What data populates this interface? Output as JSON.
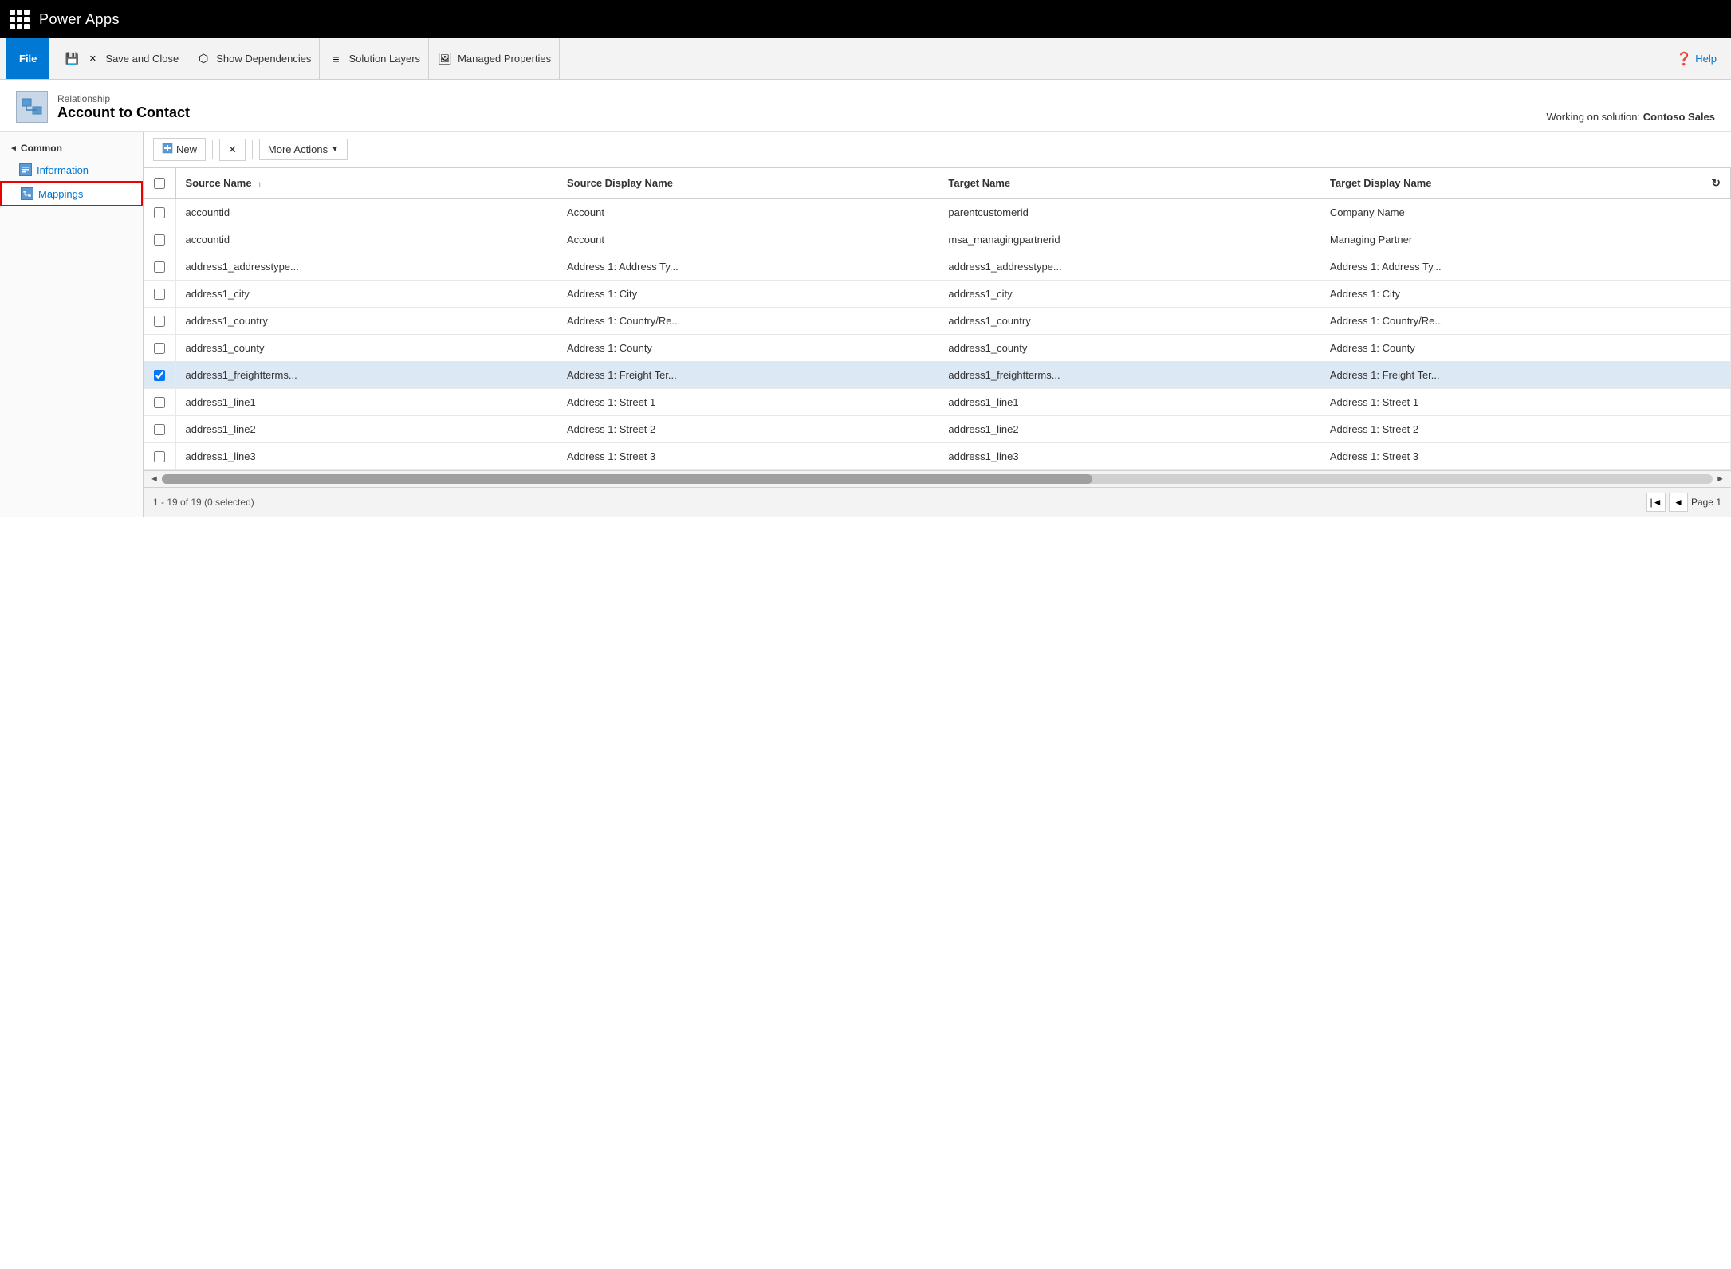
{
  "app": {
    "title": "Power Apps"
  },
  "ribbon": {
    "file_label": "File",
    "save_close_label": "Save and Close",
    "show_dependencies_label": "Show Dependencies",
    "solution_layers_label": "Solution Layers",
    "managed_properties_label": "Managed Properties",
    "help_label": "Help"
  },
  "page": {
    "subtitle": "Relationship",
    "title": "Account to Contact",
    "working_on": "Working on solution: Contoso Sales"
  },
  "sidebar": {
    "section_label": "Common",
    "items": [
      {
        "label": "Information",
        "active": false
      },
      {
        "label": "Mappings",
        "active": true
      }
    ]
  },
  "toolbar": {
    "new_label": "New",
    "delete_label": "✕",
    "more_actions_label": "More Actions"
  },
  "table": {
    "columns": [
      {
        "label": ""
      },
      {
        "label": "Source Name",
        "sortable": true,
        "sort_dir": "asc"
      },
      {
        "label": "Source Display Name",
        "sortable": false
      },
      {
        "label": "Target Name",
        "sortable": false
      },
      {
        "label": "Target Display Name",
        "sortable": false
      }
    ],
    "rows": [
      {
        "source_name": "accountid",
        "source_display": "Account",
        "target_name": "parentcustomerid",
        "target_display": "Company Name",
        "selected": false
      },
      {
        "source_name": "accountid",
        "source_display": "Account",
        "target_name": "msa_managingpartnerid",
        "target_display": "Managing Partner",
        "selected": false
      },
      {
        "source_name": "address1_addresstype...",
        "source_display": "Address 1: Address Ty...",
        "target_name": "address1_addresstype...",
        "target_display": "Address 1: Address Ty...",
        "selected": false
      },
      {
        "source_name": "address1_city",
        "source_display": "Address 1: City",
        "target_name": "address1_city",
        "target_display": "Address 1: City",
        "selected": false
      },
      {
        "source_name": "address1_country",
        "source_display": "Address 1: Country/Re...",
        "target_name": "address1_country",
        "target_display": "Address 1: Country/Re...",
        "selected": false
      },
      {
        "source_name": "address1_county",
        "source_display": "Address 1: County",
        "target_name": "address1_county",
        "target_display": "Address 1: County",
        "selected": false
      },
      {
        "source_name": "address1_freightterms...",
        "source_display": "Address 1: Freight Ter...",
        "target_name": "address1_freightterms...",
        "target_display": "Address 1: Freight Ter...",
        "selected": true
      },
      {
        "source_name": "address1_line1",
        "source_display": "Address 1: Street 1",
        "target_name": "address1_line1",
        "target_display": "Address 1: Street 1",
        "selected": false
      },
      {
        "source_name": "address1_line2",
        "source_display": "Address 1: Street 2",
        "target_name": "address1_line2",
        "target_display": "Address 1: Street 2",
        "selected": false
      },
      {
        "source_name": "address1_line3",
        "source_display": "Address 1: Street 3",
        "target_name": "address1_line3",
        "target_display": "Address 1: Street 3",
        "selected": false
      }
    ]
  },
  "status": {
    "count_label": "1 - 19 of 19 (0 selected)",
    "page_label": "Page 1"
  }
}
